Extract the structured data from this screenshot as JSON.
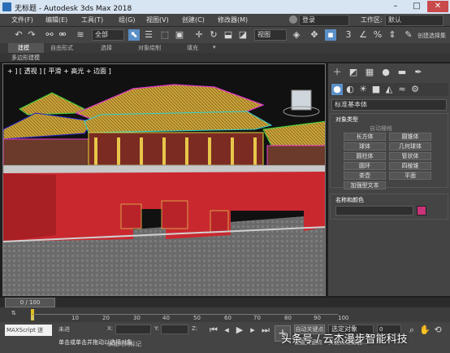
{
  "titlebar": {
    "title": "无标题 - Autodesk 3ds Max 2018",
    "min": "–",
    "max": "□",
    "close": "✕"
  },
  "menubar": {
    "items": [
      "文件(F)",
      "编辑(E)",
      "工具(T)",
      "组(G)",
      "视图(V)",
      "创建(C)",
      "修改器(M)"
    ],
    "signin": "登录",
    "workspace_label": "工作区:",
    "workspace_value": "默认"
  },
  "toolbar": {
    "selection_filter": "全部",
    "view_dropdown": "视图",
    "named_selection": "创建选择集"
  },
  "ribbon": {
    "tabs": [
      "建模",
      "自由形式",
      "选择",
      "对象绘制",
      "填充"
    ],
    "sub_label": "多边形建模"
  },
  "viewport": {
    "label": "+ ] [ 透视 ] [ 平滑 + 高光 + 边面 ]"
  },
  "command_panel": {
    "category_dropdown": "标准基本体",
    "rollout_object_type": "对象类型",
    "autogrid": "自动栅格",
    "buttons": [
      "长方体",
      "圆锥体",
      "球体",
      "几何球体",
      "圆柱体",
      "管状体",
      "圆环",
      "四棱锥",
      "茶壶",
      "平面",
      "加强型文本"
    ],
    "rollout_name_color": "名称和颜色",
    "object_color": "#c8337a"
  },
  "timeline": {
    "frame_display": "0 / 100",
    "ticks": [
      "0",
      "10",
      "20",
      "30",
      "40",
      "50",
      "60",
      "70",
      "80",
      "90",
      "100"
    ]
  },
  "status": {
    "maxscript": "MAXScript 迷",
    "selection_text": "未进",
    "prompt": "单击或单击并拖动以选择对象",
    "x_label": "X:",
    "y_label": "Y:",
    "z_label": "Z:",
    "autokey": "自动关键点",
    "set_key_dropdown": "选定对象",
    "set_key_label": "设置关键点",
    "filter": "关键点过滤器...",
    "add_time_tag": "添加时间标记",
    "frame_value": "0"
  },
  "watermark": {
    "text": "头条号 / 云杰漫步智能科技"
  }
}
